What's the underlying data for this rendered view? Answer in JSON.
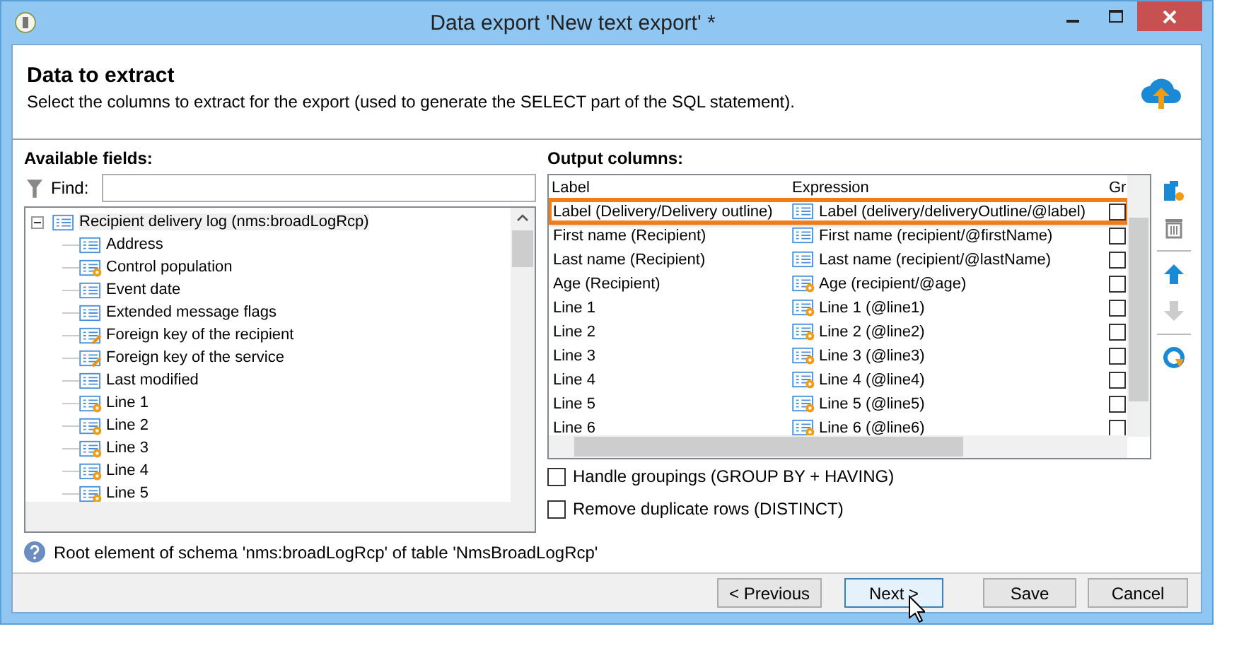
{
  "window": {
    "title": "Data export 'New text export' *"
  },
  "header": {
    "title": "Data to extract",
    "description": "Select the columns to extract for the export (used to generate the SELECT part of the SQL statement)."
  },
  "available_fields": {
    "heading": "Available fields:",
    "find_label": "Find:",
    "tree": [
      {
        "label": "Recipient delivery log (nms:broadLogRcp)",
        "kind": "list",
        "expanded": true,
        "selected": true,
        "children": [
          {
            "label": "Address",
            "kind": "list",
            "selected": false
          },
          {
            "label": "Control population",
            "kind": "calc",
            "selected": false
          },
          {
            "label": "Event date",
            "kind": "list",
            "selected": false
          },
          {
            "label": "Extended message flags",
            "kind": "list",
            "selected": false
          },
          {
            "label": "Foreign key of the recipient",
            "kind": "key",
            "selected": false
          },
          {
            "label": "Foreign key of the service",
            "kind": "key",
            "selected": false
          },
          {
            "label": "Last modified",
            "kind": "list",
            "selected": false
          },
          {
            "label": "Line 1",
            "kind": "calc",
            "selected": false
          },
          {
            "label": "Line 2",
            "kind": "calc",
            "selected": false
          },
          {
            "label": "Line 3",
            "kind": "calc",
            "selected": false
          },
          {
            "label": "Line 4",
            "kind": "calc",
            "selected": false
          },
          {
            "label": "Line 5",
            "kind": "calc",
            "selected": false
          }
        ]
      }
    ]
  },
  "output_columns": {
    "heading": "Output columns:",
    "columns": [
      "Label",
      "Expression",
      "Gr"
    ],
    "rows": [
      {
        "label": "Label (Delivery/Delivery outline)",
        "expression": "Label (delivery/deliveryOutline/@label)",
        "kind": "list",
        "checked": false,
        "selected": true
      },
      {
        "label": "First name (Recipient)",
        "expression": "First name (recipient/@firstName)",
        "kind": "list",
        "checked": false,
        "selected": false
      },
      {
        "label": "Last name (Recipient)",
        "expression": "Last name (recipient/@lastName)",
        "kind": "list",
        "checked": false,
        "selected": false
      },
      {
        "label": "Age (Recipient)",
        "expression": "Age (recipient/@age)",
        "kind": "calc",
        "checked": false,
        "selected": false
      },
      {
        "label": "Line 1",
        "expression": "Line 1 (@line1)",
        "kind": "calc",
        "checked": false,
        "selected": false
      },
      {
        "label": "Line 2",
        "expression": "Line 2 (@line2)",
        "kind": "calc",
        "checked": false,
        "selected": false
      },
      {
        "label": "Line 3",
        "expression": "Line 3 (@line3)",
        "kind": "calc",
        "checked": false,
        "selected": false
      },
      {
        "label": "Line 4",
        "expression": "Line 4 (@line4)",
        "kind": "calc",
        "checked": false,
        "selected": false
      },
      {
        "label": "Line 5",
        "expression": "Line 5 (@line5)",
        "kind": "calc",
        "checked": false,
        "selected": false
      },
      {
        "label": "Line 6",
        "expression": "Line 6 (@line6)",
        "kind": "calc",
        "checked": false,
        "selected": false
      }
    ],
    "options": [
      {
        "label": "Handle groupings (GROUP BY + HAVING)",
        "checked": false
      },
      {
        "label": "Remove duplicate rows (DISTINCT)",
        "checked": false
      }
    ]
  },
  "status": "Root element of schema 'nms:broadLogRcp' of table 'NmsBroadLogRcp'",
  "buttons": [
    {
      "label": "< Previous",
      "focused": false
    },
    {
      "label": "Next >",
      "focused": true
    },
    {
      "label": "Save",
      "focused": false
    },
    {
      "label": "Cancel",
      "focused": false
    }
  ]
}
